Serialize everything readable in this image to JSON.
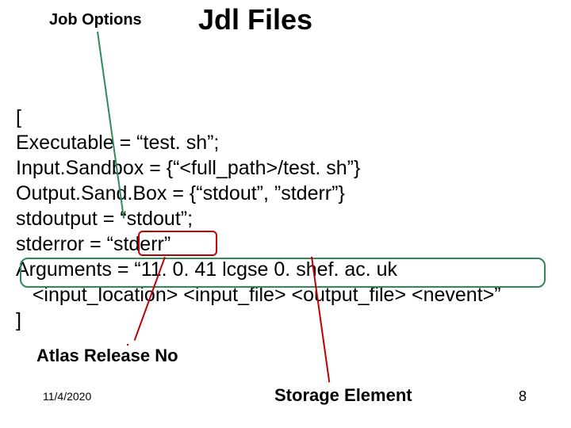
{
  "header": {
    "job_options": "Job Options",
    "title": "Jdl Files"
  },
  "code": {
    "line1": "[",
    "line2": "Executable = “test. sh”;",
    "line3": "Input.Sandbox = {“<full_path>/test. sh”}",
    "line4": "Output.Sand.Box = {“stdout”, ”stderr”}",
    "line5": "stdoutput = “stdout”;",
    "line6": "stderror = “stderr”",
    "line7": "Arguments = “11. 0. 41 lcgse 0. shef. ac. uk",
    "line8": "   <input_location> <input_file> <output_file> <nevent>”",
    "line9": "]"
  },
  "labels": {
    "atlas": "Atlas Release No",
    "storage": "Storage Element"
  },
  "footer": {
    "date": "11/4/2020",
    "page": "8"
  }
}
